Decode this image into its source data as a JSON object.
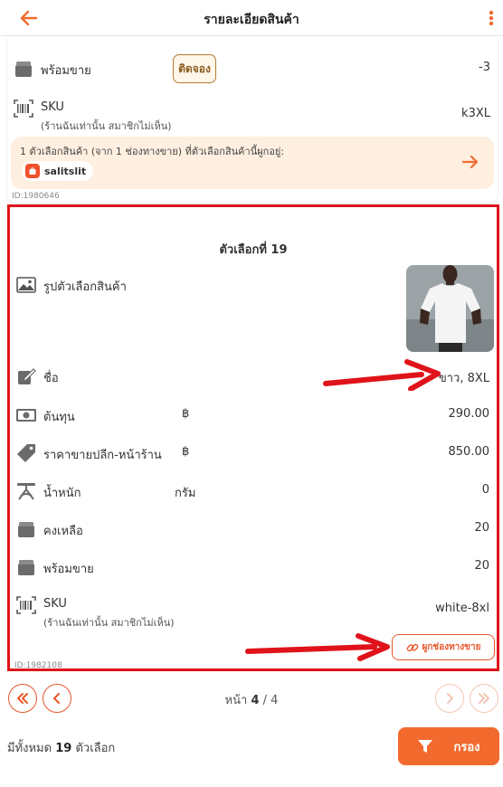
{
  "header": {
    "title": "รายละเอียดสินค้า",
    "back_icon": "arrow-left-icon",
    "more_icon": "kebab-menu-icon",
    "accent_color": "#f26a2e"
  },
  "previous_variant": {
    "ready_label": "พร้อมขาย",
    "reserve_badge": "ติดจอง",
    "ready_value": "-3",
    "sku_label": "SKU",
    "sku_note": "(ร้านฉันเท่านั้น สมาชิกไม่เห็น)",
    "sku_value": "k3XL",
    "channel_text": "1 ตัวเลือกสินค้า (จาก 1 ช่องทางขาย) ที่ตัวเลือกสินค้านี้ผูกอยู่:",
    "channel_shop": "salitslit",
    "id_text": "ID:1980646"
  },
  "variant": {
    "title": "ตัวเลือกที่ 19",
    "image_label": "รูปตัวเลือกสินค้า",
    "fields": {
      "name": {
        "label": "ชื่อ",
        "value": "ขาว, 8XL"
      },
      "cost": {
        "label": "ต้นทุน",
        "unit": "฿",
        "value": "290.00"
      },
      "retail_price": {
        "label": "ราคาขายปลีก-หน้าร้าน",
        "unit": "฿",
        "value": "850.00"
      },
      "weight": {
        "label": "น้ำหนัก",
        "unit": "กรัม",
        "value": "0"
      },
      "remaining": {
        "label": "คงเหลือ",
        "value": "20"
      },
      "ready": {
        "label": "พร้อมขาย",
        "value": "20"
      },
      "sku": {
        "label": "SKU",
        "note": "(ร้านฉันเท่านั้น สมาชิกไม่เห็น)",
        "value": "white-8xl"
      }
    },
    "bind_button": "ผูกช่องทางขาย",
    "id_text": "ID:1982108",
    "highlight_color": "#e0131a"
  },
  "pagination": {
    "prefix": "หน้า",
    "current": "4",
    "separator": "/",
    "total": "4"
  },
  "footer": {
    "total_prefix": "มีทั้งหมด",
    "total_count": "19",
    "total_suffix": "ตัวเลือก",
    "filter_label": "กรอง"
  }
}
